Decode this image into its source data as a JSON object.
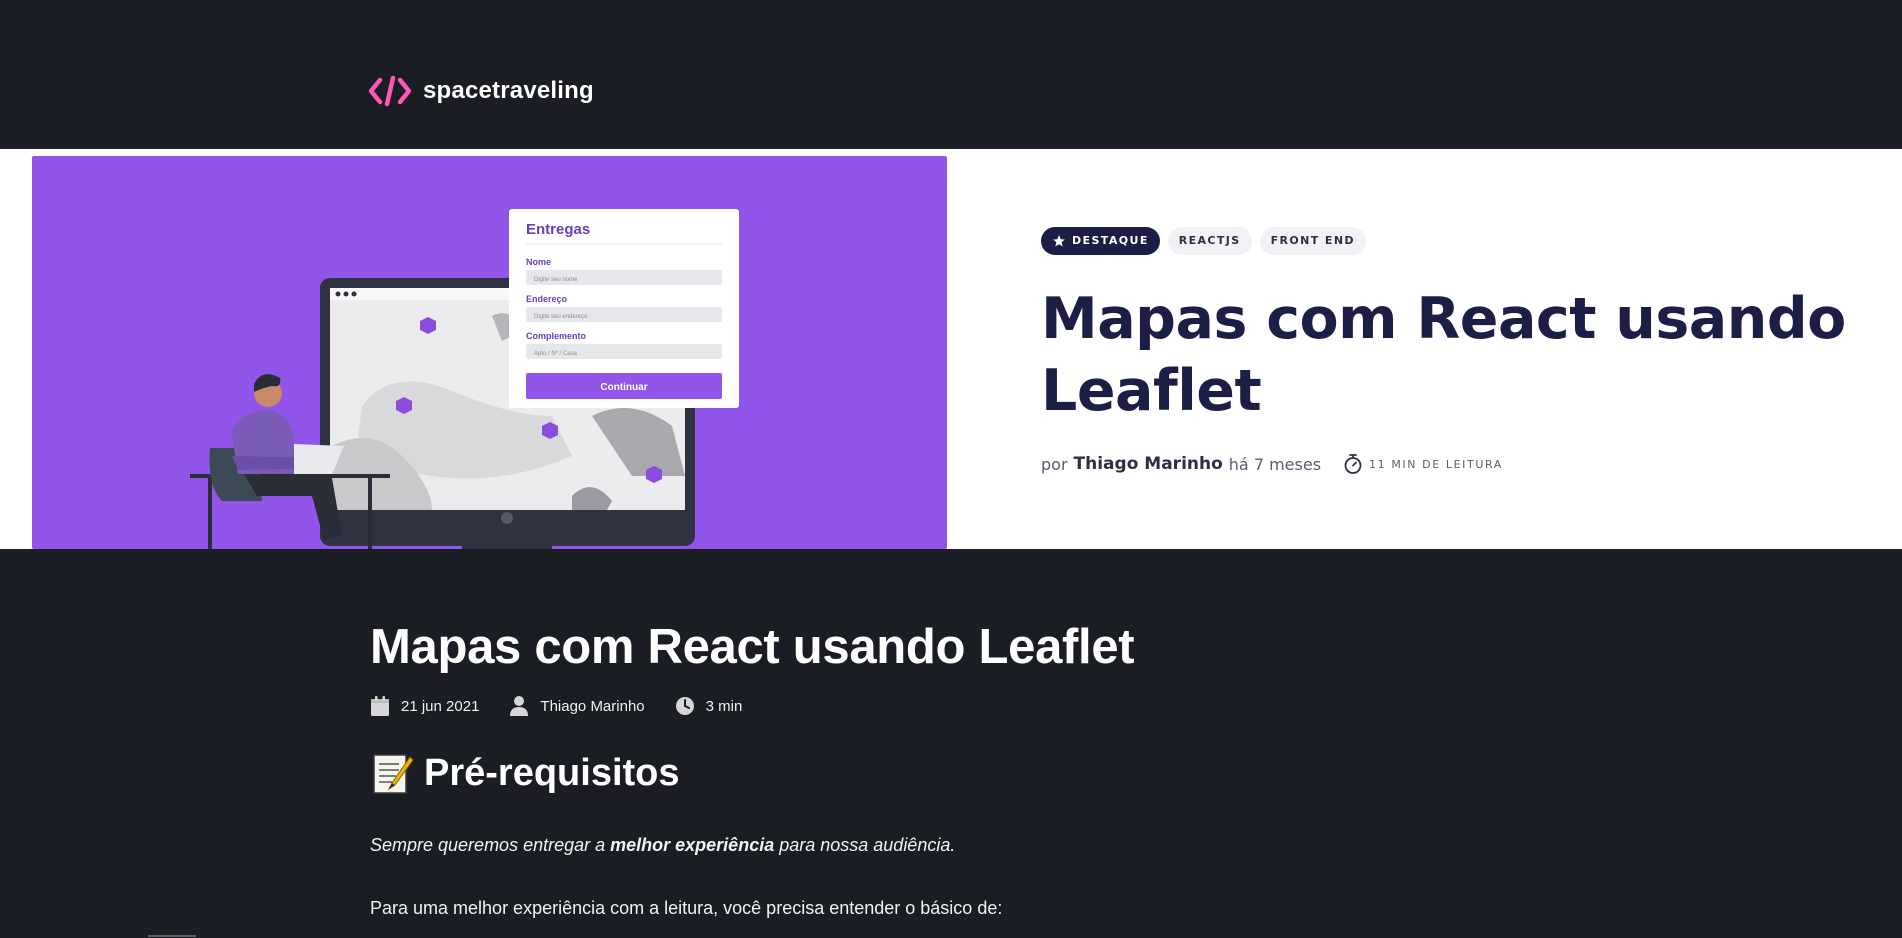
{
  "header": {
    "brand_name": "spacetraveling",
    "logo_icon": "code-brackets-icon",
    "accent_color": "#ff57b2"
  },
  "banner": {
    "image": {
      "form_title": "Entregas",
      "field_1_label": "Nome",
      "field_1_placeholder": "Digite seu nome",
      "field_2_label": "Endereço",
      "field_2_placeholder": "Digite seu endereço",
      "field_3_label": "Complemento",
      "field_3_placeholder": "Apto / Nº / Casa",
      "button_label": "Continuar",
      "background_color": "#9155e9"
    },
    "tags": [
      {
        "label": "DESTAQUE",
        "icon": "star-icon"
      },
      {
        "label": "REACTJS"
      },
      {
        "label": "FRONT END"
      }
    ],
    "title": "Mapas com React usando Leaflet",
    "byline_prefix": "por",
    "author": "Thiago Marinho",
    "relative_time": "há 7 meses",
    "reading_time": "11 MIN DE LEITURA"
  },
  "post": {
    "title": "Mapas com React usando Leaflet",
    "date": "21 jun 2021",
    "author": "Thiago Marinho",
    "read_time": "3 min",
    "section_title": "Pré-requisitos",
    "intro_before": "Sempre queremos entregar a ",
    "intro_bold": "melhor experiência",
    "intro_after": " para nossa audiência.",
    "body": "Para uma melhor experiência com a leitura, você precisa entender o básico de:"
  }
}
